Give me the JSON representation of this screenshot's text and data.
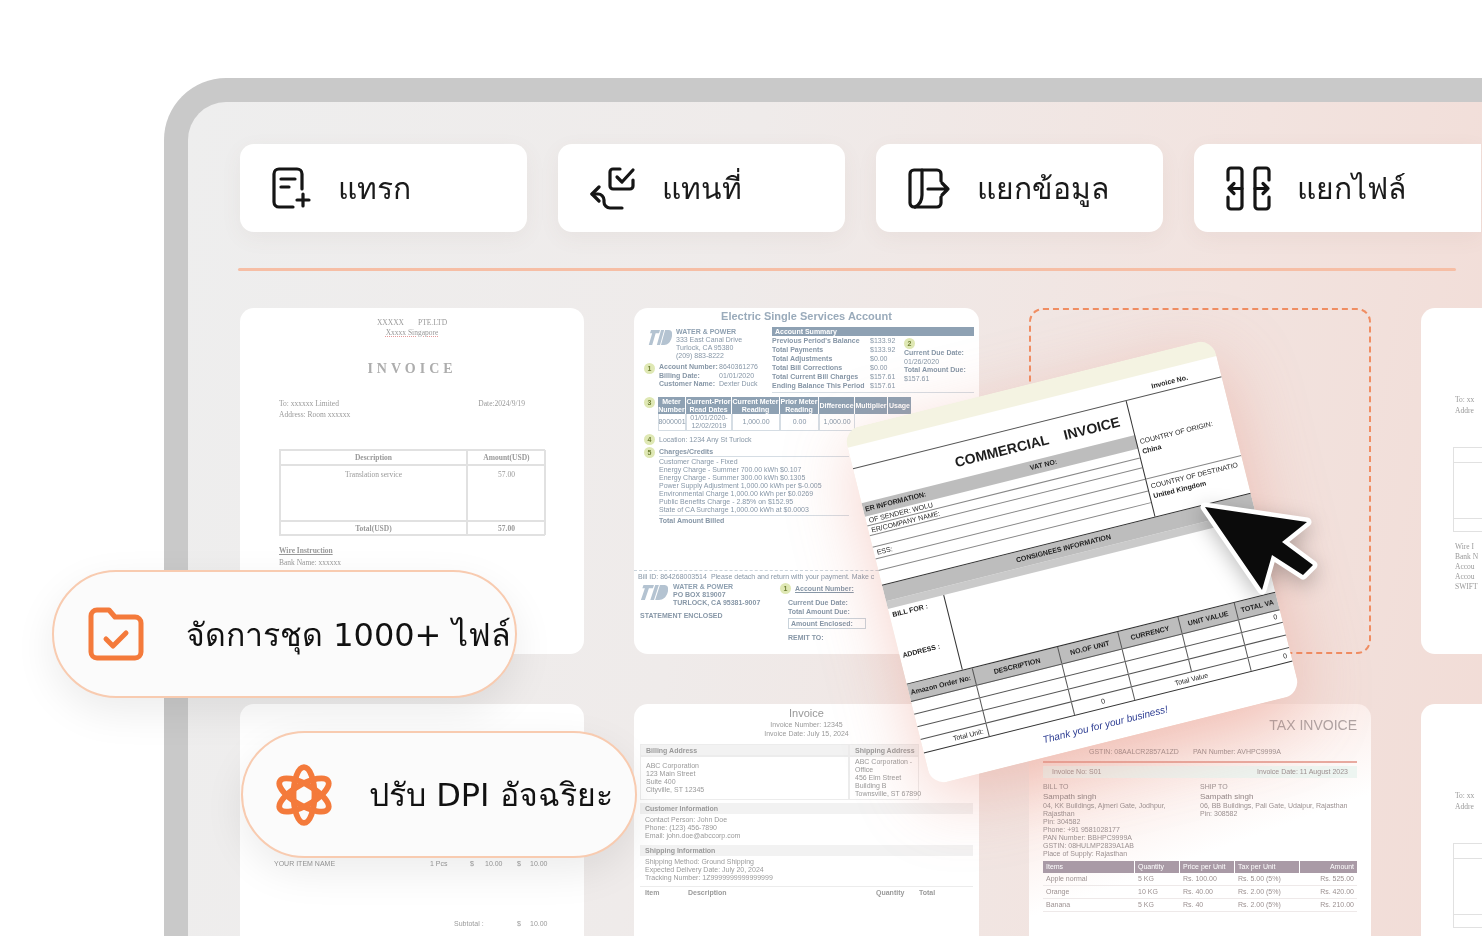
{
  "toolbar": [
    {
      "kind": "insert",
      "label": "แทรก"
    },
    {
      "kind": "replace",
      "label": "แทนที่"
    },
    {
      "kind": "extract",
      "label": "แยกข้อมูล"
    },
    {
      "kind": "split",
      "label": "แยกไฟล์"
    }
  ],
  "documents": {
    "row_1": [
      {
        "kind": "letter_invoice",
        "company": [
          "XXXXX",
          "PTE.LTD"
        ],
        "location": "Xxxxx Singapore",
        "title": "INVOICE",
        "recipient": "To: xxxxxx Limited",
        "date": "Date:2024/9/19",
        "address": "Address: Room xxxxxx",
        "columns": [
          "Description",
          "Amount(USD)"
        ],
        "rows": [
          [
            "Translation service",
            "57.00"
          ]
        ],
        "total": [
          "Total(USD)",
          "57.00"
        ],
        "notes": {
          "heading": "Wire Instruction",
          "lines": [
            "Bank Name: xxxxxx"
          ]
        }
      },
      {
        "kind": "utility_bill",
        "title": "Electric Single Services Account",
        "company": {
          "name": "WATER & POWER",
          "lines": [
            "333 East Canal Drive",
            "Turlock, CA 95380",
            "(209) 883-8222"
          ]
        },
        "account": {
          "marker": "1",
          "fields": [
            [
              "Account Number:",
              "8640361276"
            ],
            [
              "Billing Date:",
              "01/01/2020"
            ],
            [
              "Customer Name:",
              "Dexter Duck"
            ]
          ]
        },
        "summary": {
          "heading": "Account Summary",
          "rows": [
            [
              "Previous Period's Balance",
              "$133.92"
            ],
            [
              "Total Payments",
              "$133.92"
            ],
            [
              "Total Adjustments",
              "$0.00"
            ],
            [
              "Total Bill Corrections",
              "$0.00"
            ],
            [
              "Total Current Bill Charges",
              "$157.61"
            ],
            [
              "Ending Balance This Period",
              "$157.61"
            ]
          ],
          "marker": "2",
          "due": [
            [
              "Current Due Date:",
              "01/26/2020"
            ],
            [
              "Total Amount Due:",
              "$157.61"
            ]
          ]
        },
        "meter": {
          "marker": "3",
          "columns": [
            "Meter Number",
            "Current-Prior Read Dates",
            "Current Meter Reading",
            "Prior Meter Reading",
            "Difference",
            "Multiplier",
            "Usage"
          ],
          "row": [
            "8000001",
            "01/01/2020-12/02/2019",
            "1,000.00",
            "0.00",
            "1,000.00"
          ]
        },
        "location": {
          "marker": "4",
          "text": "Location: 1234 Any St Turlock"
        },
        "charges": {
          "marker": "5",
          "heading": "Charges/Credits",
          "lines": [
            "Customer Charge - Fixed",
            "Energy Charge - Summer 700.00 kWh $0.107",
            "Energy Charge - Summer 300.00 kWh $0.1305",
            "Power Supply Adjustment 1,000.00 kWh per $-0.005",
            "Environmental Charge 1,000.00 kWh per $0.0269",
            "Public Benefits Charge - 2.85% on $152.95",
            "State of CA Surcharge 1,000.00 kWh at $0.0003"
          ],
          "total": "Total Amount Billed"
        },
        "stub": {
          "bill_id": "Bill ID: 864268003514",
          "notice": "Please detach and return with your payment. Make c",
          "company": "WATER & POWER",
          "lines": [
            "PO BOX 819007",
            "TURLOCK, CA 95381-9007"
          ],
          "status": "STATEMENT ENCLOSED",
          "marker": "1",
          "account_label": "Account Number:",
          "fields": [
            "Current Due Date:",
            "Total Amount Due:"
          ],
          "boxed_field": "Amount Enclosed:",
          "remit": "REMIT TO:"
        }
      },
      {
        "kind": "drop_target"
      },
      {
        "kind": "letter_edge",
        "header": [
          "To: xx",
          "Addre"
        ],
        "notes": [
          "Wire I",
          "Bank N",
          "Accou",
          "Accou",
          "SWIFT"
        ]
      }
    ],
    "row_2": [
      {
        "kind": "item_list",
        "rows": [
          [
            "YOUR ITEM NAME",
            "1 Pcs",
            "$",
            "10.00",
            "$",
            "10.00"
          ]
        ],
        "subtotal": [
          "Subtotal :",
          "$",
          "10.00"
        ]
      },
      {
        "kind": "detailed_invoice",
        "title": "Invoice",
        "meta": [
          "Invoice Number: 12345",
          "Invoice Date: July 15, 2024"
        ],
        "addresses": [
          {
            "heading": "Billing Address",
            "lines": [
              "ABC Corporation",
              "123 Main Street",
              "Suite 400",
              "Cityville, ST 12345"
            ]
          },
          {
            "heading": "Shipping Address",
            "lines": [
              "ABC Corporation -",
              "Office",
              "456 Elm Street",
              "Building B",
              "Townsville, ST 67890"
            ]
          }
        ],
        "sections": [
          {
            "heading": "Customer Information",
            "lines": [
              "Contact Person: John Doe",
              "Phone: (123) 456-7890",
              "Email: john.doe@abccorp.com"
            ]
          },
          {
            "heading": "Shipping Information",
            "lines": [
              "Shipping Method: Ground Shipping",
              "Expected Delivery Date: July 20, 2024",
              "Tracking Number: 1Z9999999999999999"
            ]
          }
        ],
        "columns": [
          "Item",
          "Description",
          "Quantity",
          "Total"
        ]
      },
      {
        "kind": "tax_invoice",
        "title": "TAX INVOICE",
        "ids": [
          "GSTIN: 08AALCR2857A1ZD",
          "PAN Number: AVHPC9999A"
        ],
        "invoice_no": "Invoice No: S01",
        "invoice_date": "Invoice Date: 11 August 2023",
        "parties": [
          {
            "heading": "BILL TO",
            "name": "Sampath singh",
            "lines": [
              "04, KK Buildings, Ajmeri Gate, Jodhpur, Rajasthan",
              "Pin: 304582",
              "Phone: +91 9581028177",
              "PAN Number: BBHPC9999A",
              "GSTIN: 08HULMP2839A1AB",
              "Place of Supply: Rajasthan"
            ]
          },
          {
            "heading": "SHIP TO",
            "name": "Sampath singh",
            "lines": [
              "06, BB Buildings, Pali Gate, Udaipur, Rajasthan",
              "Pin: 308582"
            ]
          }
        ],
        "columns": [
          "Items",
          "Quantity",
          "Price per Unit",
          "Tax per Unit",
          "Amount"
        ],
        "rows": [
          [
            "Apple normal",
            "5 KG",
            "Rs. 100.00",
            "Rs. 5.00 (5%)",
            "Rs. 525.00"
          ],
          [
            "Orange",
            "10 KG",
            "Rs. 40.00",
            "Rs. 2.00 (5%)",
            "Rs. 420.00"
          ],
          [
            "Banana",
            "5 KG",
            "Rs. 40",
            "Rs. 2.00 (5%)",
            "Rs. 210.00"
          ]
        ]
      },
      {
        "kind": "letter_edge",
        "header": [
          "To: xx",
          "Addre"
        ]
      }
    ]
  },
  "dragged_document": {
    "invoice_no": "Invoice No.",
    "title": "COMMERCIAL INVOICE",
    "band": [
      "ER INFORMATION:",
      "VAT NO:"
    ],
    "sender_lines": [
      "OF SENDER: WOLU",
      "ER/COMPANY NAME:"
    ],
    "address_label": "ESS:",
    "origin": [
      "COUNTRY OF ORIGIN:",
      "China"
    ],
    "destination": [
      "COUNTRY OF DESTINATIO",
      "United Kingdom"
    ],
    "consignee_heading": "CONSIGNEES INFORMATION",
    "bill_labels": [
      "BILL FOR :",
      "ADDRESS :"
    ],
    "columns": [
      "Amazon Order No:",
      "DESCRIPTION",
      "NO.OF UNIT",
      "CURRENCY",
      "UNIT VALUE",
      "TOTAL VA"
    ],
    "line_items": [
      {
        "total": "0"
      }
    ],
    "totals": {
      "unit_label": "Total Unit:",
      "units": "0",
      "value_label": "Total Value",
      "value": "0"
    },
    "thanks": "Thank you for your business!"
  },
  "highlights": [
    {
      "kind": "batch",
      "label": "จัดการชุด 1000+ ไฟล์"
    },
    {
      "kind": "dpi",
      "label": "ปรับ DPI อัจฉริยะ"
    }
  ]
}
